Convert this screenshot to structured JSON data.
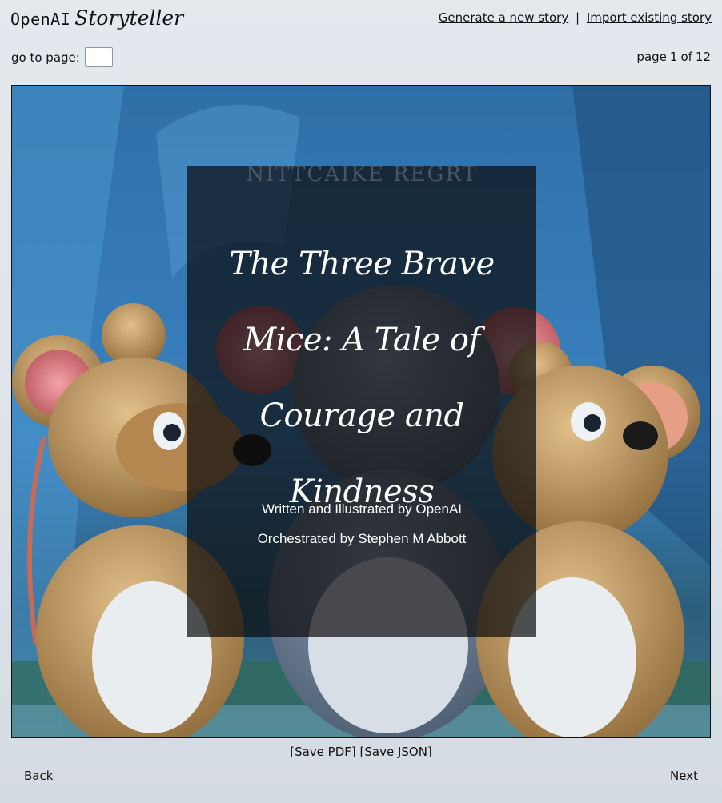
{
  "header": {
    "brand": "OpenAI",
    "brand_script": "Storyteller",
    "links": {
      "generate": "Generate a new story",
      "separator": "|",
      "import": "Import existing story"
    },
    "goto_label": "go to page:",
    "goto_value": "",
    "page_indicator": {
      "prefix": "page",
      "current": "1",
      "of": "of",
      "total": "12"
    }
  },
  "cover": {
    "watermark_text": "NITTCAIKE REGRT",
    "title_lines": [
      "The Three Brave",
      "Mice: A Tale of",
      "Courage and Kindness"
    ],
    "credit_author": "Written and Illustrated by OpenAI",
    "credit_orchestrator": "Orchestrated by Stephen M Abbott"
  },
  "footer": {
    "save_pdf": "Save PDF",
    "save_json": "Save JSON",
    "back": "Back",
    "next": "Next"
  },
  "colors": {
    "background": "#dde3e9",
    "overlay": "rgba(10,10,12,0.70)",
    "scene_blue": "#3f7fb8",
    "mouse_tan": "#c49a5c",
    "ear_pink": "#d66c72"
  }
}
